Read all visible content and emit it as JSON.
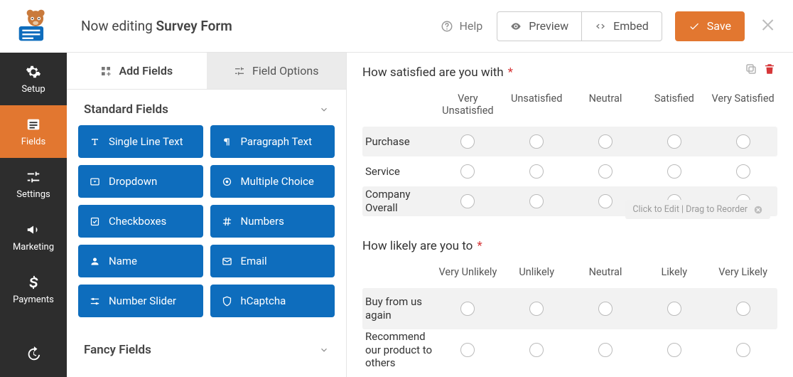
{
  "header": {
    "editing_prefix": "Now editing",
    "form_name": "Survey Form",
    "help": "Help",
    "preview": "Preview",
    "embed": "Embed",
    "save": "Save"
  },
  "nav": {
    "items": [
      {
        "key": "setup",
        "label": "Setup",
        "icon": "gear",
        "active": false
      },
      {
        "key": "fields",
        "label": "Fields",
        "icon": "form",
        "active": true
      },
      {
        "key": "settings",
        "label": "Settings",
        "icon": "sliders",
        "active": false
      },
      {
        "key": "marketing",
        "label": "Marketing",
        "icon": "bullhorn",
        "active": false
      },
      {
        "key": "payments",
        "label": "Payments",
        "icon": "dollar",
        "active": false
      }
    ],
    "history_icon": "history"
  },
  "sidebar": {
    "tabs": {
      "add": "Add Fields",
      "options": "Field Options"
    },
    "sections": [
      {
        "title": "Standard Fields",
        "open": true,
        "fields": [
          {
            "label": "Single Line Text",
            "icon": "text"
          },
          {
            "label": "Paragraph Text",
            "icon": "paragraph"
          },
          {
            "label": "Dropdown",
            "icon": "dropdown"
          },
          {
            "label": "Multiple Choice",
            "icon": "radio"
          },
          {
            "label": "Checkboxes",
            "icon": "check"
          },
          {
            "label": "Numbers",
            "icon": "hash"
          },
          {
            "label": "Name",
            "icon": "user"
          },
          {
            "label": "Email",
            "icon": "mail"
          },
          {
            "label": "Number Slider",
            "icon": "slider"
          },
          {
            "label": "hCaptcha",
            "icon": "shield"
          }
        ]
      },
      {
        "title": "Fancy Fields",
        "open": false,
        "fields": []
      }
    ]
  },
  "canvas": {
    "questions": [
      {
        "title": "How satisfied are you with",
        "required": true,
        "columns": [
          "Very Unsatisfied",
          "Unsatisfied",
          "Neutral",
          "Satisfied",
          "Very Satisfied"
        ],
        "rows": [
          "Purchase",
          "Service",
          "Company Overall"
        ],
        "show_tools": true,
        "show_hint": true
      },
      {
        "title": "How likely are you to",
        "required": true,
        "columns": [
          "Very Unlikely",
          "Unlikely",
          "Neutral",
          "Likely",
          "Very Likely"
        ],
        "rows": [
          "Buy from us again",
          "Recommend our product to others"
        ],
        "show_tools": false,
        "show_hint": false
      }
    ],
    "hint": "Click to Edit | Drag to Reorder"
  },
  "colors": {
    "accent": "#e27730",
    "primary": "#0e6dbd",
    "nav": "#2d2d2d"
  }
}
